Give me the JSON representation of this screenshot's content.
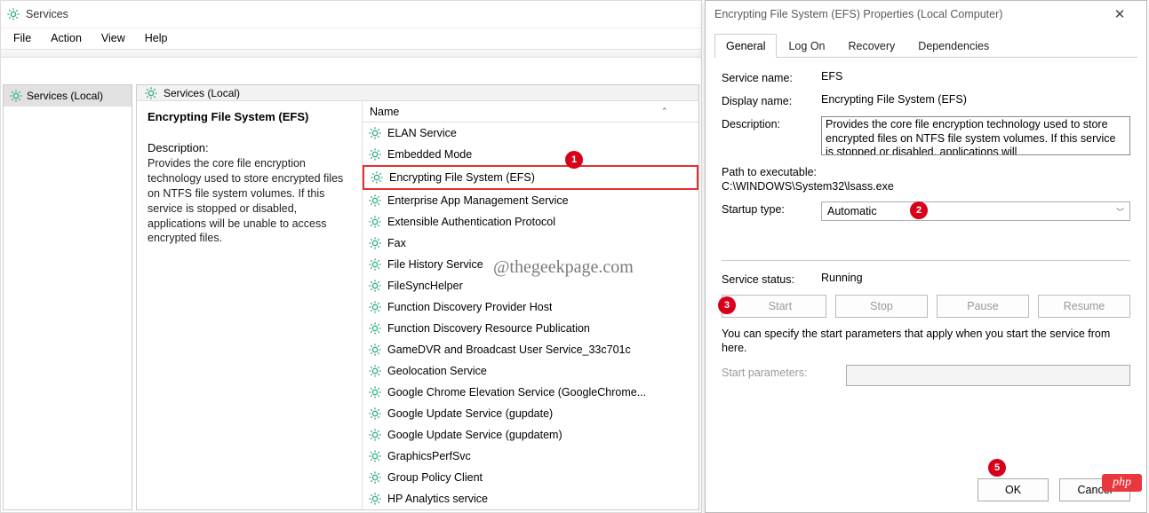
{
  "services_window": {
    "title": "Services",
    "menu": [
      "File",
      "Action",
      "View",
      "Help"
    ],
    "tree_item": "Services (Local)",
    "pane_header": "Services (Local)",
    "column_header": "Name",
    "selected_service_title": "Encrypting File System (EFS)",
    "desc_label": "Description:",
    "selected_service_desc": "Provides the core file encryption technology used to store encrypted files on NTFS file system volumes. If this service is stopped or disabled, applications will be unable to access encrypted files.",
    "services": [
      "ELAN Service",
      "Embedded Mode",
      "Encrypting File System (EFS)",
      "Enterprise App Management Service",
      "Extensible Authentication Protocol",
      "Fax",
      "File History Service",
      "FileSyncHelper",
      "Function Discovery Provider Host",
      "Function Discovery Resource Publication",
      "GameDVR and Broadcast User Service_33c701c",
      "Geolocation Service",
      "Google Chrome Elevation Service (GoogleChrome...",
      "Google Update Service (gupdate)",
      "Google Update Service (gupdatem)",
      "GraphicsPerfSvc",
      "Group Policy Client",
      "HP Analytics service"
    ],
    "highlight_index": 2
  },
  "watermark": "@thegeekpage.com",
  "props_dialog": {
    "title": "Encrypting File System (EFS) Properties (Local Computer)",
    "tabs": [
      "General",
      "Log On",
      "Recovery",
      "Dependencies"
    ],
    "active_tab": 0,
    "service_name_label": "Service name:",
    "service_name": "EFS",
    "display_name_label": "Display name:",
    "display_name": "Encrypting File System (EFS)",
    "description_label": "Description:",
    "description": "Provides the core file encryption technology used to store encrypted files on NTFS file system volumes. If this service is stopped or disabled, applications will",
    "path_label": "Path to executable:",
    "path_value": "C:\\WINDOWS\\System32\\lsass.exe",
    "startup_label": "Startup type:",
    "startup_value": "Automatic",
    "status_label": "Service status:",
    "status_value": "Running",
    "buttons": {
      "start": "Start",
      "stop": "Stop",
      "pause": "Pause",
      "resume": "Resume"
    },
    "hint": "You can specify the start parameters that apply when you start the service from here.",
    "start_params_label": "Start parameters:",
    "ok": "OK",
    "cancel": "Cancel"
  },
  "annotations": [
    "1",
    "2",
    "3",
    "5"
  ],
  "php_badge": "php"
}
